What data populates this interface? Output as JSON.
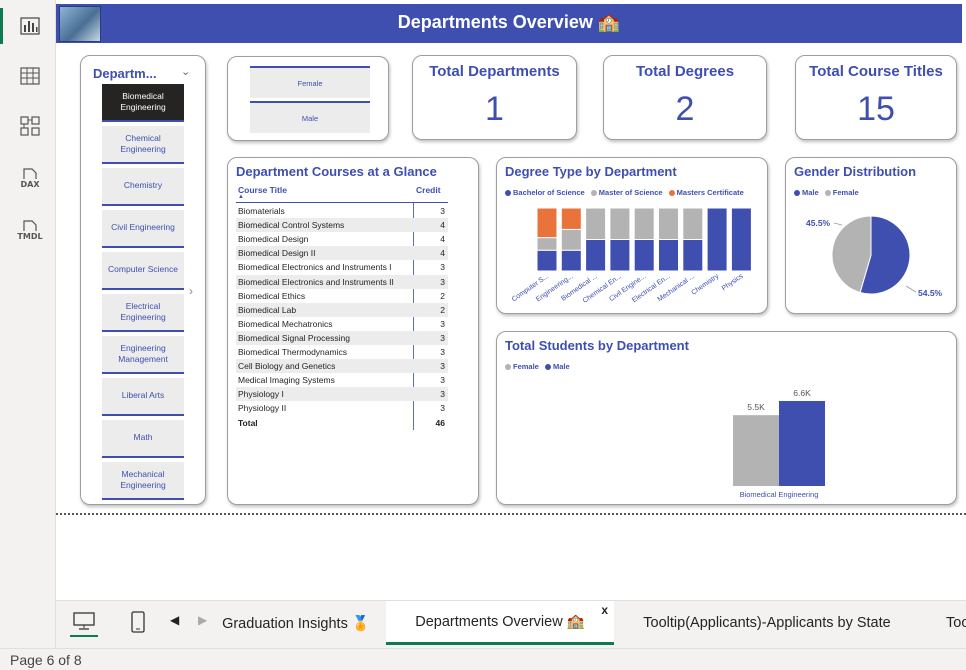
{
  "banner": {
    "title": "Departments Overview 🏫"
  },
  "rail": {
    "icons": [
      "report-view-icon",
      "table-view-icon",
      "model-view-icon",
      "dax-query-icon",
      "tmdl-view-icon"
    ],
    "dax_label": "DAX",
    "tmdl_label": "TMDL"
  },
  "slicer": {
    "title": "Departm...",
    "items": [
      "Biomedical Engineering",
      "Chemical Engineering",
      "Chemistry",
      "Civil Engineering",
      "Computer Science",
      "Electrical Engineering",
      "Engineering Management",
      "Liberal Arts",
      "Math",
      "Mechanical Engineering"
    ],
    "selected": "Biomedical Engineering"
  },
  "gender_slicer": {
    "items": [
      "Female",
      "Male"
    ]
  },
  "kpis": [
    {
      "title": "Total Departments",
      "value": "1"
    },
    {
      "title": "Total Degrees",
      "value": "2"
    },
    {
      "title": "Total Course Titles",
      "value": "15"
    }
  ],
  "course_table": {
    "title": "Department Courses at a Glance",
    "columns": [
      "Course Title",
      "Credit"
    ],
    "rows": [
      [
        "Biomaterials",
        "3"
      ],
      [
        "Biomedical Control Systems",
        "4"
      ],
      [
        "Biomedical Design",
        "4"
      ],
      [
        "Biomedical Design II",
        "4"
      ],
      [
        "Biomedical Electronics and Instruments I",
        "3"
      ],
      [
        "Biomedical Electronics and Instruments II",
        "3"
      ],
      [
        "Biomedical Ethics",
        "2"
      ],
      [
        "Biomedical Lab",
        "2"
      ],
      [
        "Biomedical Mechatronics",
        "3"
      ],
      [
        "Biomedical Signal Processing",
        "3"
      ],
      [
        "Biomedical Thermodynamics",
        "3"
      ],
      [
        "Cell Biology and Genetics",
        "3"
      ],
      [
        "Medical Imaging Systems",
        "3"
      ],
      [
        "Physiology I",
        "3"
      ],
      [
        "Physiology II",
        "3"
      ]
    ],
    "total_label": "Total",
    "total_value": "46"
  },
  "colors": {
    "primary": "#3f4fb0",
    "grey": "#b3b3b3",
    "orange": "#e8743b",
    "dark": "#252423"
  },
  "chart_data": [
    {
      "type": "bar",
      "title": "Degree Type by Department",
      "stacked": "100%",
      "categories": [
        "Computer S...",
        "Engineering...",
        "Biomedical ...",
        "Chemical En...",
        "Civil Engine...",
        "Electrical En...",
        "Mechanical ...",
        "Chemistry",
        "Physics"
      ],
      "series": [
        {
          "name": "Bachelor of Science",
          "color": "#3f4fb0",
          "values": [
            33,
            33,
            50,
            50,
            50,
            50,
            50,
            100,
            100
          ]
        },
        {
          "name": "Master of Science",
          "color": "#b3b3b3",
          "values": [
            20,
            33,
            50,
            50,
            50,
            50,
            50,
            0,
            0
          ]
        },
        {
          "name": "Masters Certificate",
          "color": "#e8743b",
          "values": [
            47,
            34,
            0,
            0,
            0,
            0,
            0,
            0,
            0
          ]
        }
      ],
      "ylim": [
        0,
        100
      ],
      "legend": "top-left"
    },
    {
      "type": "pie",
      "title": "Gender Distribution",
      "series": [
        {
          "name": "Male",
          "color": "#3f4fb0",
          "value": 54.5
        },
        {
          "name": "Female",
          "color": "#b3b3b3",
          "value": 45.5
        }
      ],
      "labels": [
        "54.5%",
        "45.5%"
      ],
      "legend": "top-left"
    },
    {
      "type": "bar",
      "title": "Total Students by Department",
      "categories": [
        "Biomedical Engineering"
      ],
      "series": [
        {
          "name": "Female",
          "color": "#b3b3b3",
          "values": [
            5.5
          ]
        },
        {
          "name": "Male",
          "color": "#3f4fb0",
          "values": [
            6.6
          ]
        }
      ],
      "data_labels": [
        "5.5K",
        "6.6K"
      ],
      "unit": "K",
      "ylim": [
        0,
        6.6
      ],
      "legend": "top-left"
    }
  ],
  "tabs": {
    "items": [
      "Graduation Insights 🏅",
      "Departments Overview 🏫",
      "Tooltip(Applicants)-Applicants by State",
      "Too"
    ],
    "active": "Departments Overview 🏫",
    "close_label": "x"
  },
  "status": {
    "page": "Page 6 of 8"
  }
}
